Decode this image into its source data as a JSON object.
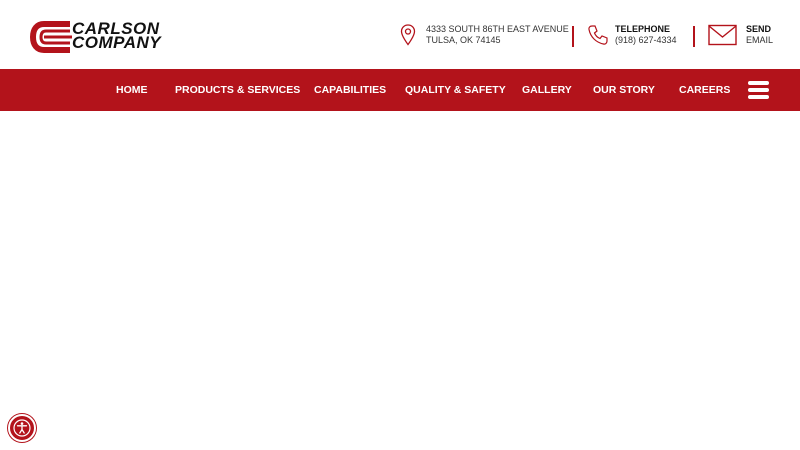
{
  "brand": {
    "name_line1": "CARLSON",
    "name_line2": "COMPANY",
    "accent_color": "#b3131b"
  },
  "contacts": {
    "address": {
      "line1": "4333 SOUTH 86TH EAST AVENUE",
      "line2": "TULSA, OK 74145",
      "icon": "map-pin-icon"
    },
    "phone": {
      "label": "TELEPHONE",
      "value": "(918) 627-4334",
      "icon": "phone-icon"
    },
    "email": {
      "label": "SEND",
      "value": "EMAIL",
      "icon": "envelope-icon"
    }
  },
  "nav": {
    "items": [
      {
        "label": "HOME"
      },
      {
        "label": "PRODUCTS & SERVICES"
      },
      {
        "label": "CAPABILITIES"
      },
      {
        "label": "QUALITY & SAFETY"
      },
      {
        "label": "GALLERY"
      },
      {
        "label": "OUR STORY"
      },
      {
        "label": "CAREERS"
      }
    ],
    "menu_icon": "hamburger-menu-icon"
  },
  "accessibility": {
    "icon": "accessibility-icon"
  }
}
